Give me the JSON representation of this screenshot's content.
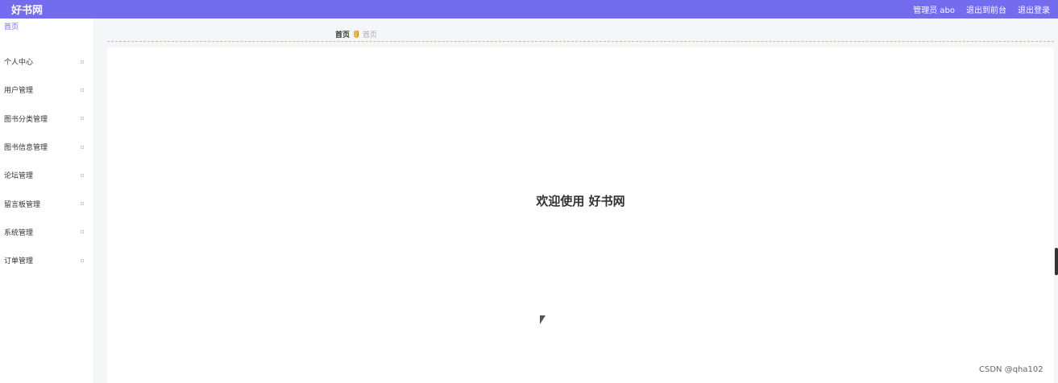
{
  "app": {
    "title": "好书网",
    "admin_label": "管理员 abo",
    "to_frontend": "退出到前台",
    "logout": "退出登录",
    "accent_color": "#736cef"
  },
  "sidebar": {
    "items": [
      {
        "label": "首页"
      },
      {
        "label": "个人中心"
      },
      {
        "label": "用户管理"
      },
      {
        "label": "图书分类管理"
      },
      {
        "label": "图书信息管理"
      },
      {
        "label": "论坛管理"
      },
      {
        "label": "留言板管理"
      },
      {
        "label": "系统管理"
      },
      {
        "label": "订单管理"
      }
    ]
  },
  "breadcrumb": {
    "home": "首页",
    "current": "首页"
  },
  "main": {
    "welcome": "欢迎使用 好书网"
  },
  "watermark": "CSDN @qha102"
}
